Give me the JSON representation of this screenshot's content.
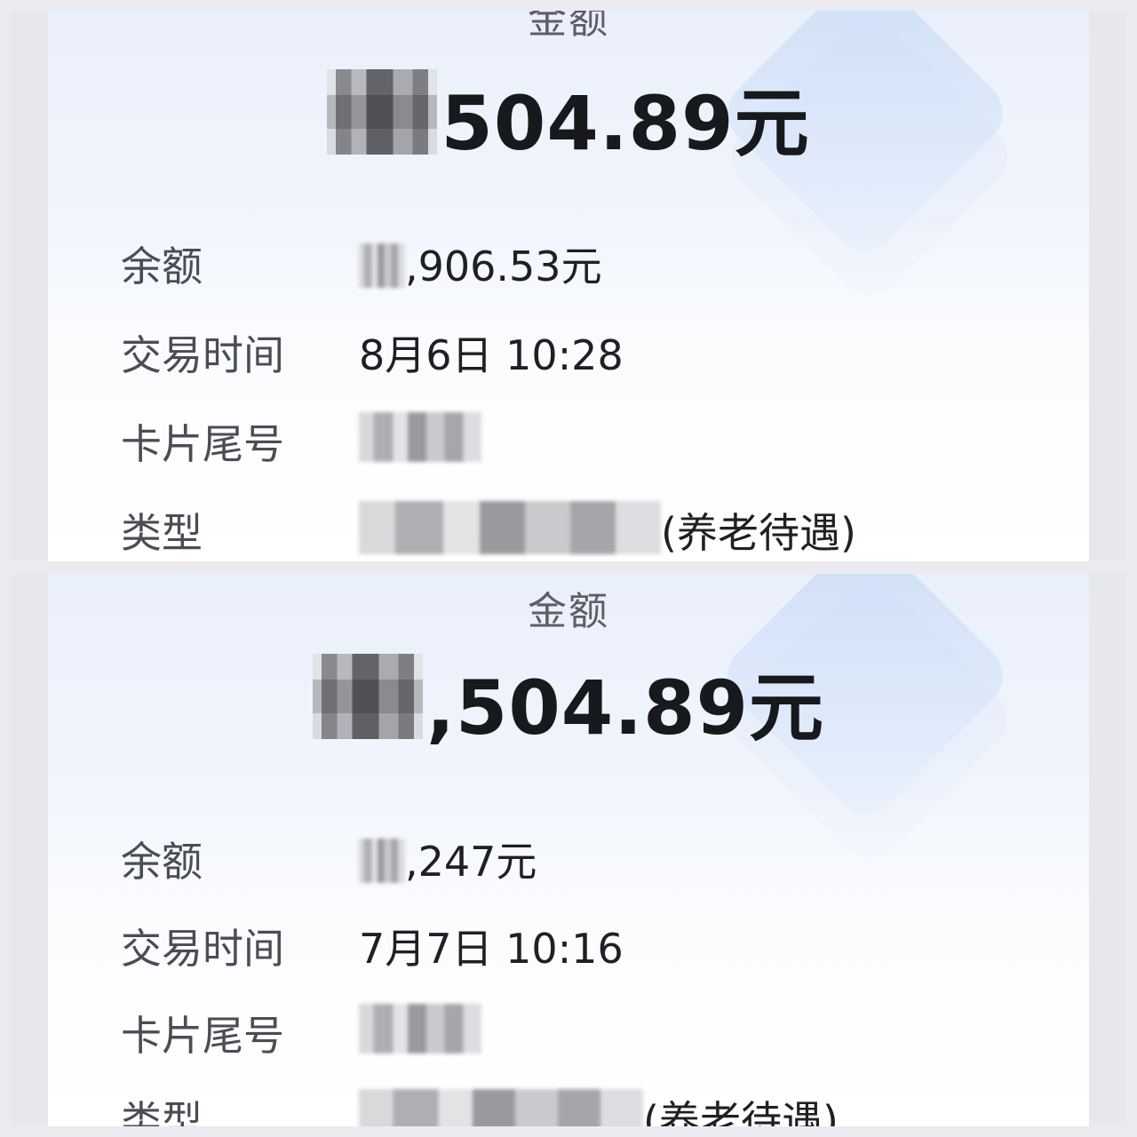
{
  "screens": [
    {
      "amount_label": "金额",
      "amount_visible": "504.89元",
      "balance_label": "余额",
      "balance_visible": ",906.53元",
      "time_label": "交易时间",
      "time_value": "8月6日 10:28",
      "card_label": "卡片尾号",
      "type_label": "类型",
      "type_visible": "(养老待遇)"
    },
    {
      "amount_label": "金额",
      "amount_visible": ",504.89元",
      "balance_label": "余额",
      "balance_visible": ",247元",
      "time_label": "交易时间",
      "time_value": "7月7日 10:16",
      "card_label": "卡片尾号",
      "type_label": "类型",
      "type_visible": "(养老待遇)"
    }
  ]
}
